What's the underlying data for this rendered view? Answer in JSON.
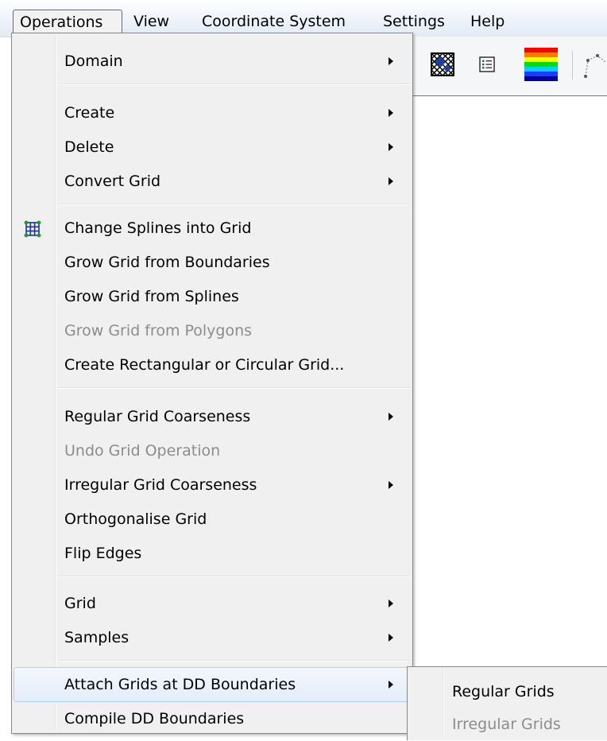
{
  "menubar": {
    "items": [
      "Operations",
      "View",
      "Coordinate System",
      "Settings",
      "Help"
    ]
  },
  "operations_menu": {
    "items": [
      {
        "label": "Domain",
        "submenu": true,
        "enabled": true
      },
      {
        "label": "Create",
        "submenu": true,
        "enabled": true
      },
      {
        "label": "Delete",
        "submenu": true,
        "enabled": true
      },
      {
        "label": "Convert Grid",
        "submenu": true,
        "enabled": true
      },
      {
        "label": "Change Splines into Grid",
        "submenu": false,
        "enabled": true,
        "icon": "grid-icon"
      },
      {
        "label": "Grow Grid from Boundaries",
        "submenu": false,
        "enabled": true
      },
      {
        "label": "Grow Grid from Splines",
        "submenu": false,
        "enabled": true
      },
      {
        "label": "Grow Grid from Polygons",
        "submenu": false,
        "enabled": false
      },
      {
        "label": "Create Rectangular or Circular Grid...",
        "submenu": false,
        "enabled": true
      },
      {
        "label": "Regular Grid Coarseness",
        "submenu": true,
        "enabled": true
      },
      {
        "label": "Undo Grid Operation",
        "submenu": false,
        "enabled": false
      },
      {
        "label": "Irregular Grid Coarseness",
        "submenu": true,
        "enabled": true
      },
      {
        "label": "Orthogonalise Grid",
        "submenu": false,
        "enabled": true
      },
      {
        "label": "Flip Edges",
        "submenu": false,
        "enabled": true
      },
      {
        "label": "Grid",
        "submenu": true,
        "enabled": true
      },
      {
        "label": "Samples",
        "submenu": true,
        "enabled": true
      },
      {
        "label": "Attach Grids at DD Boundaries",
        "submenu": true,
        "enabled": true,
        "highlighted": true
      },
      {
        "label": "Compile DD Boundaries",
        "submenu": false,
        "enabled": true
      }
    ]
  },
  "attach_submenu": {
    "items": [
      {
        "label": "Regular Grids",
        "enabled": true
      },
      {
        "label": "Irregular Grids",
        "enabled": false
      }
    ]
  },
  "toolbar": {
    "icons": [
      "mesh-icon",
      "list-icon",
      "color-scale-icon",
      "polyline-icon"
    ]
  },
  "colors": {
    "menu_bg": "#f0f0f0",
    "highlight": "#e3edfa",
    "disabled_text": "#8c8c8c"
  }
}
